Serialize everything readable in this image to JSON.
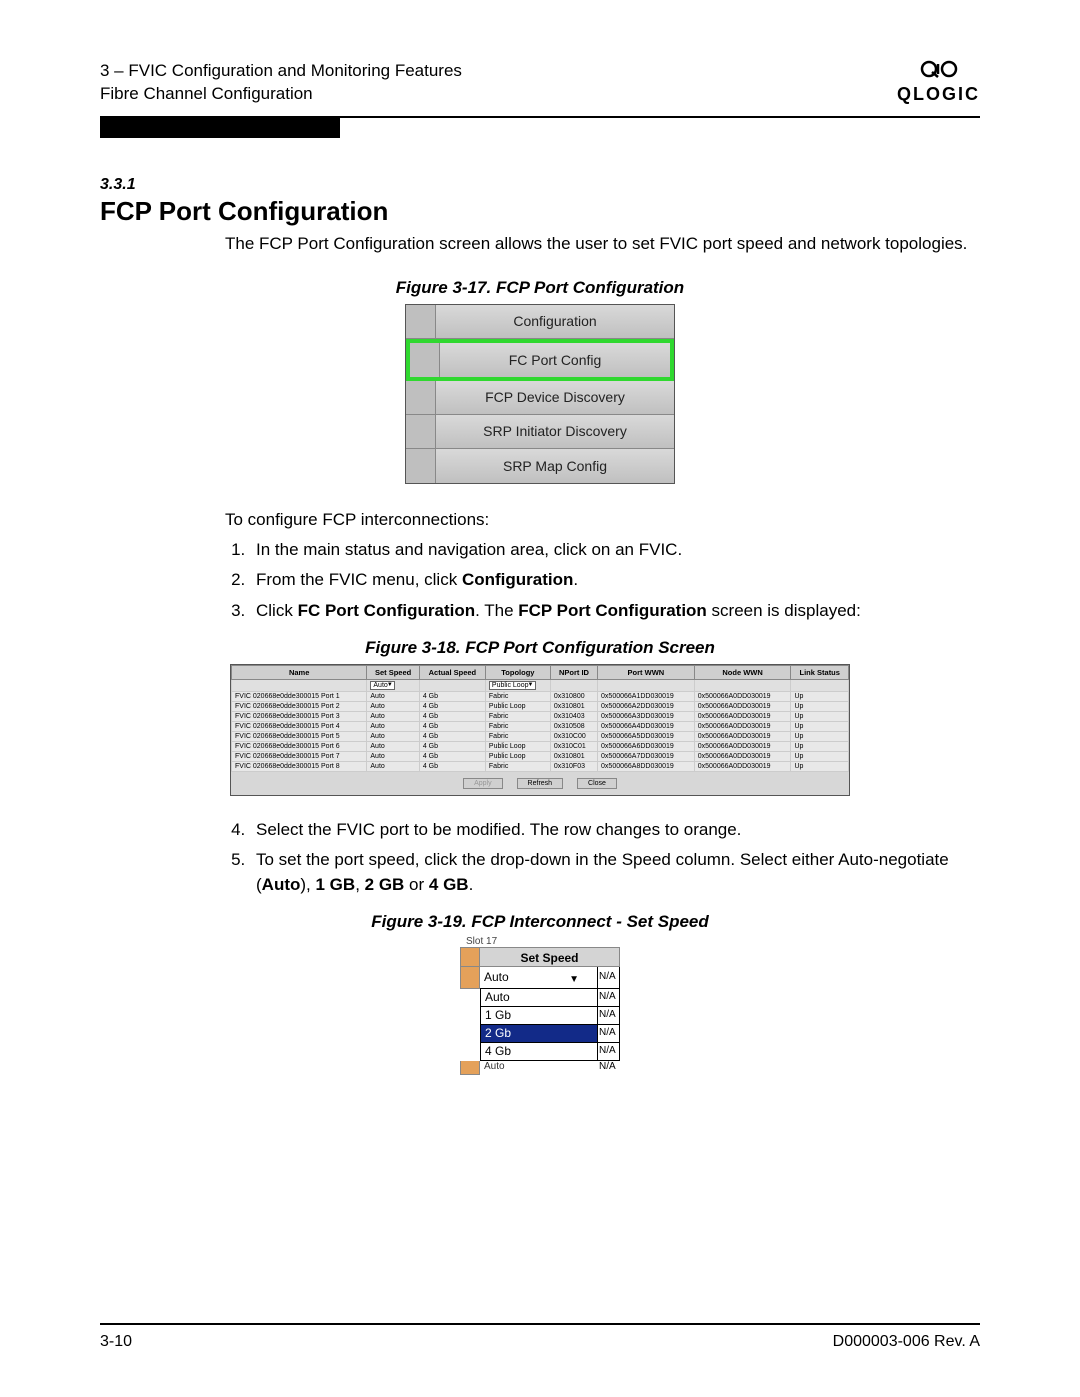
{
  "header": {
    "line1": "3 – FVIC Configuration and Monitoring Features",
    "line2": "Fibre Channel Configuration",
    "logo_text": "QLOGIC"
  },
  "section": {
    "number": "3.3.1",
    "title": "FCP Port Configuration",
    "intro": "The FCP Port Configuration screen allows the user to set FVIC port speed and network topologies."
  },
  "figure17": {
    "caption": "Figure 3-17. FCP Port Configuration",
    "items": [
      {
        "label": "Configuration",
        "selected": false
      },
      {
        "label": "FC Port Config",
        "selected": true
      },
      {
        "label": "FCP Device Discovery",
        "selected": false
      },
      {
        "label": "SRP Initiator Discovery",
        "selected": false
      },
      {
        "label": "SRP Map Config",
        "selected": false
      }
    ]
  },
  "instructions": {
    "lead": "To configure FCP interconnections:",
    "step1": "In the main status and navigation area, click on an FVIC.",
    "step2_a": "From the FVIC menu, click ",
    "step2_b": "Configuration",
    "step2_c": ".",
    "step3_a": "Click ",
    "step3_b": "FC Port Configuration",
    "step3_c": ". The ",
    "step3_d": "FCP Port Configuration",
    "step3_e": " screen is displayed:"
  },
  "figure18": {
    "caption": "Figure 3-18. FCP Port Configuration Screen",
    "columns": [
      "Name",
      "Set Speed",
      "Actual Speed",
      "Topology",
      "NPort ID",
      "Port WWN",
      "Node WWN",
      "Link Status"
    ],
    "filter_speed": "Auto",
    "filter_topology": "Public Loop",
    "rows": [
      {
        "name": "FVIC 020668e0dde300015 Port 1",
        "set": "Auto",
        "act": "4 Gb",
        "topo": "Fabric",
        "nport": "0x310800",
        "pwwn": "0x500066A1DD030019",
        "nwwn": "0x500066A0DD030019",
        "link": "Up"
      },
      {
        "name": "FVIC 020668e0dde300015 Port 2",
        "set": "Auto",
        "act": "4 Gb",
        "topo": "Public Loop",
        "nport": "0x310801",
        "pwwn": "0x500066A2DD030019",
        "nwwn": "0x500066A0DD030019",
        "link": "Up"
      },
      {
        "name": "FVIC 020668e0dde300015 Port 3",
        "set": "Auto",
        "act": "4 Gb",
        "topo": "Fabric",
        "nport": "0x310403",
        "pwwn": "0x500066A3DD030019",
        "nwwn": "0x500066A0DD030019",
        "link": "Up"
      },
      {
        "name": "FVIC 020668e0dde300015 Port 4",
        "set": "Auto",
        "act": "4 Gb",
        "topo": "Fabric",
        "nport": "0x310508",
        "pwwn": "0x500066A4DD030019",
        "nwwn": "0x500066A0DD030019",
        "link": "Up"
      },
      {
        "name": "FVIC 020668e0dde300015 Port 5",
        "set": "Auto",
        "act": "4 Gb",
        "topo": "Fabric",
        "nport": "0x310C00",
        "pwwn": "0x500066A5DD030019",
        "nwwn": "0x500066A0DD030019",
        "link": "Up"
      },
      {
        "name": "FVIC 020668e0dde300015 Port 6",
        "set": "Auto",
        "act": "4 Gb",
        "topo": "Public Loop",
        "nport": "0x310C01",
        "pwwn": "0x500066A6DD030019",
        "nwwn": "0x500066A0DD030019",
        "link": "Up"
      },
      {
        "name": "FVIC 020668e0dde300015 Port 7",
        "set": "Auto",
        "act": "4 Gb",
        "topo": "Public Loop",
        "nport": "0x310801",
        "pwwn": "0x500066A7DD030019",
        "nwwn": "0x500066A0DD030019",
        "link": "Up"
      },
      {
        "name": "FVIC 020668e0dde300015 Port 8",
        "set": "Auto",
        "act": "4 Gb",
        "topo": "Fabric",
        "nport": "0x310F03",
        "pwwn": "0x500066A8DD030019",
        "nwwn": "0x500066A0DD030019",
        "link": "Up"
      }
    ],
    "buttons": {
      "apply": "Apply",
      "refresh": "Refresh",
      "close": "Close"
    }
  },
  "step4": "Select the FVIC port to be modified. The row changes to orange.",
  "step5": {
    "a": "To set the port speed, click the drop-down in the Speed column. Select either Auto-negotiate (",
    "b": "Auto",
    "c": "), ",
    "d": "1 GB",
    "e": ", ",
    "f": "2 GB",
    "g": " or ",
    "h": "4 GB",
    "i": "."
  },
  "figure19": {
    "caption": "Figure 3-19. FCP Interconnect - Set Speed",
    "tab": "Slot 17",
    "header": "Set Speed",
    "selected": "Auto",
    "na": "N/A",
    "options": [
      "Auto",
      "1 Gb",
      "2 Gb",
      "4 Gb"
    ],
    "selected_index": 2,
    "below": "Auto"
  },
  "footer": {
    "left": "3-10",
    "right": "D000003-006 Rev. A"
  }
}
